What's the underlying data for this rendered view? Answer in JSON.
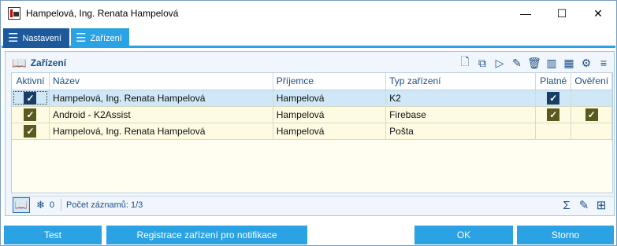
{
  "window": {
    "title": "Hampelová, Ing. Renata Hampelová",
    "controls": {
      "minimize": "—",
      "maximize": "☐",
      "close": "✕"
    }
  },
  "tabs": [
    {
      "label": "Nastavení",
      "icon": "list-icon",
      "active": false
    },
    {
      "label": "Zařízení",
      "icon": "list-icon",
      "active": true
    }
  ],
  "panel": {
    "title": "Zařízení",
    "toolbar_icons": [
      "new-document-icon",
      "copy-icon",
      "play-icon",
      "edit-icon",
      "delete-icon",
      "chart-icon",
      "columns-icon",
      "settings-icon",
      "menu-icon"
    ]
  },
  "table": {
    "columns": [
      "Aktivní",
      "Název",
      "Příjemce",
      "Typ zařízení",
      "Platné",
      "Ověření"
    ],
    "rows": [
      {
        "aktivni": true,
        "nazev": "Hampelová, Ing. Renata Hampelová",
        "prijemce": "Hampelová",
        "typ": "K2",
        "platne": true,
        "overeni": false,
        "selected": true
      },
      {
        "aktivni": true,
        "nazev": "Android - K2Assist",
        "prijemce": "Hampelová",
        "typ": "Firebase",
        "platne": true,
        "overeni": true,
        "selected": false
      },
      {
        "aktivni": true,
        "nazev": "Hampelová, Ing. Renata Hampelová",
        "prijemce": "Hampelová",
        "typ": "Pošta",
        "platne": false,
        "overeni": false,
        "selected": false
      }
    ]
  },
  "statusbar": {
    "filter_count": "0",
    "records": "Počet záznamů: 1/3"
  },
  "buttons": {
    "test": "Test",
    "registrace": "Registrace zařízení pro notifikace",
    "ok": "OK",
    "storno": "Storno"
  },
  "colors": {
    "accent": "#2aa2e4",
    "tab_dark": "#1c5a9c",
    "checkbox": "#5a5a1e",
    "row_bg": "#fffbe3",
    "selected_bg": "#cfe7f6"
  }
}
